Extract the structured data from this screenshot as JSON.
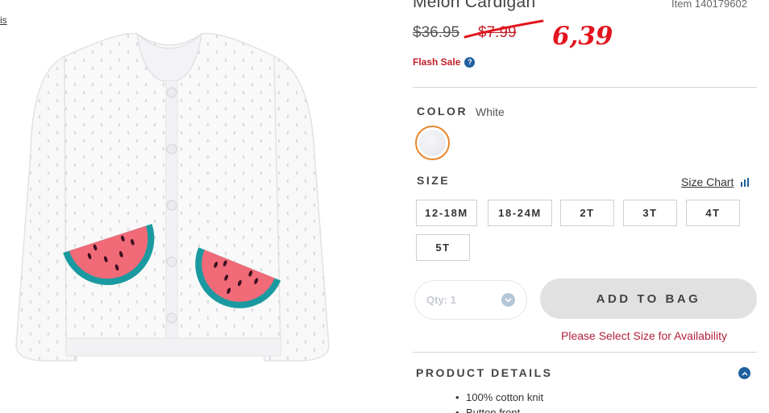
{
  "nav": {
    "left_link": "is"
  },
  "product": {
    "title": "Melon Cardigan",
    "item_number": "Item 140179602",
    "original_price": "$36.95",
    "sale_price": "$7.99",
    "handwritten_price": "6,39",
    "flash_sale_label": "Flash Sale",
    "help_icon_glyph": "?",
    "image": {
      "description_icon": "cardigan-image",
      "body_color": "#f8f8f8",
      "pocket_flesh_color": "#f06a78",
      "pocket_rind_color": "#1a9aa0"
    }
  },
  "color": {
    "label": "COLOR",
    "value": "White",
    "accent": "#e8862c"
  },
  "size": {
    "label": "SIZE",
    "chart_link": "Size Chart",
    "options": [
      "12-18M",
      "18-24M",
      "2T",
      "3T",
      "4T",
      "5T"
    ]
  },
  "purchase": {
    "qty_label": "Qty: 1",
    "add_to_bag": "ADD TO BAG",
    "warning": "Please Select Size for Availability"
  },
  "details": {
    "heading": "PRODUCT DETAILS",
    "items": [
      "100% cotton knit",
      "Button front"
    ]
  },
  "colors": {
    "brand_blue": "#1f5f9e",
    "sale_red": "#c41f2a",
    "annotation_red": "#e3141d"
  }
}
